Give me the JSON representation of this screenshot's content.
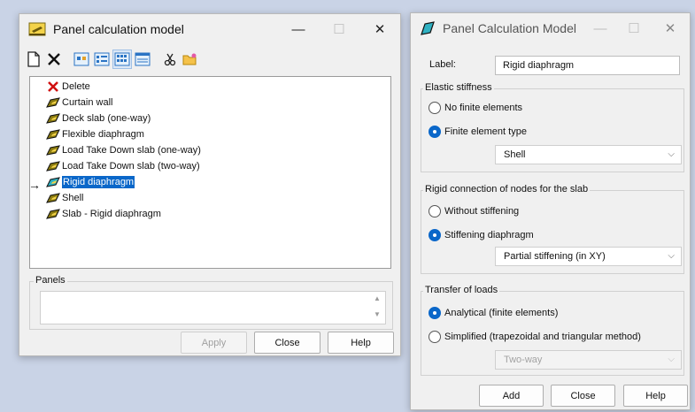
{
  "left_window": {
    "title": "Panel calculation model",
    "controls": {
      "minimize": "—",
      "maximize": "☐",
      "close": "✕"
    },
    "list_items": [
      {
        "label": "Delete",
        "icon": "delete-x-icon"
      },
      {
        "label": "Curtain wall",
        "icon": "panel-icon"
      },
      {
        "label": "Deck slab (one-way)",
        "icon": "panel-icon"
      },
      {
        "label": "Flexible diaphragm",
        "icon": "panel-icon"
      },
      {
        "label": "Load Take Down slab (one-way)",
        "icon": "panel-icon"
      },
      {
        "label": "Load Take Down slab (two-way)",
        "icon": "panel-icon"
      },
      {
        "label": "Rigid diaphragm",
        "icon": "panel-icon",
        "selected": true
      },
      {
        "label": "Shell",
        "icon": "panel-icon"
      },
      {
        "label": "Slab - Rigid diaphragm",
        "icon": "panel-icon"
      }
    ],
    "arrow": "→",
    "panels_label": "Panels",
    "panels_value": "",
    "buttons": {
      "apply": "Apply",
      "close": "Close",
      "help": "Help"
    }
  },
  "right_window": {
    "title": "Panel Calculation Model",
    "controls": {
      "minimize": "—",
      "maximize": "☐",
      "close": "✕"
    },
    "label_caption": "Label:",
    "label_value": "Rigid diaphragm",
    "elastic": {
      "legend": "Elastic stiffness",
      "options": [
        "No finite elements",
        "Finite element type"
      ],
      "selected_index": 1,
      "select_value": "Shell"
    },
    "rigid": {
      "legend": "Rigid connection of nodes for the slab",
      "options": [
        "Without stiffening",
        "Stiffening diaphragm"
      ],
      "selected_index": 1,
      "select_value": "Partial stiffening (in XY)"
    },
    "transfer": {
      "legend": "Transfer of loads",
      "options": [
        "Analytical (finite elements)",
        "Simplified (trapezoidal and triangular method)"
      ],
      "selected_index": 0,
      "select_value": "Two-way"
    },
    "buttons": {
      "add": "Add",
      "close": "Close",
      "help": "Help"
    }
  },
  "colors": {
    "accent": "#0a67c9",
    "panel_icon": "#8a7a10"
  }
}
